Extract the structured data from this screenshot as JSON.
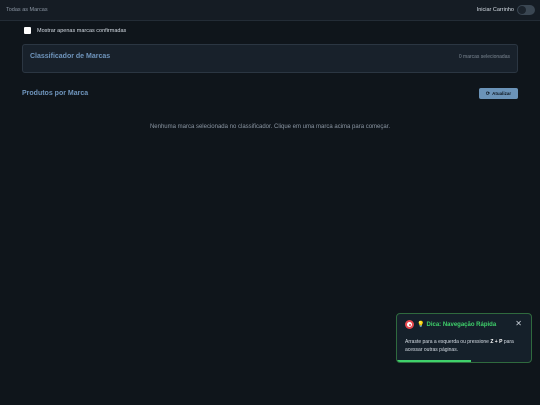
{
  "header": {
    "breadcrumb": "Todas as Marcas",
    "cart_toggle_label": "Iniciar Carrinho",
    "cart_toggle_on": false
  },
  "filter": {
    "confirmed_only_label": "Mostrar apenas marcas confirmadas",
    "confirmed_only_checked": false
  },
  "classifier": {
    "title": "Classificador de Marcas",
    "selected_count": "0 marcas selecionadas"
  },
  "products": {
    "title": "Produtos por Marca",
    "refresh_label": "Atualizar",
    "empty_message": "Nenhuma marca selecionada no classificador. Clique em uma marca acima para começar."
  },
  "toast": {
    "title": "Dica: Navegação Rápida",
    "body_before": "Arraste para a esquerda ou pressione ",
    "shortcut": "Z + P",
    "body_after": " para acessar outras páginas.",
    "close_symbol": "✕",
    "progress": 0.55
  },
  "colors": {
    "accent": "#6f95bd",
    "success": "#3fd16b",
    "background": "#0f151b"
  },
  "icons": [
    "target-icon",
    "lightbulb-icon",
    "close-icon",
    "refresh-icon"
  ]
}
